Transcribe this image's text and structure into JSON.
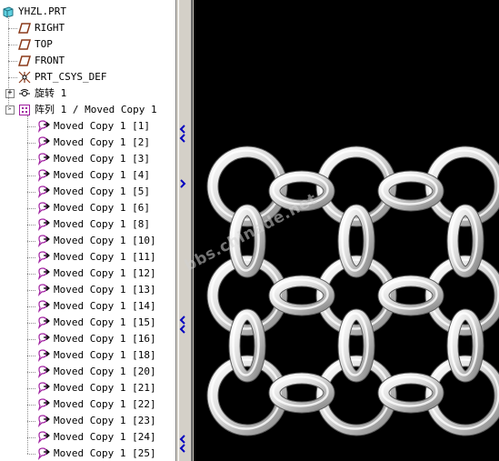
{
  "tree": {
    "root_label": "YHZL.PRT",
    "datum_planes": [
      "RIGHT",
      "TOP",
      "FRONT"
    ],
    "csys_label": "PRT_CSYS_DEF",
    "revolve_label": "旋转 1",
    "pattern_label": "阵列 1 / Moved Copy 1",
    "pattern_children": [
      "Moved Copy 1 [1]",
      "Moved Copy 1 [2]",
      "Moved Copy 1 [3]",
      "Moved Copy 1 [4]",
      "Moved Copy 1 [5]",
      "Moved Copy 1 [6]",
      "Moved Copy 1 [8]",
      "Moved Copy 1 [10]",
      "Moved Copy 1 [11]",
      "Moved Copy 1 [12]",
      "Moved Copy 1 [13]",
      "Moved Copy 1 [14]",
      "Moved Copy 1 [15]",
      "Moved Copy 1 [16]",
      "Moved Copy 1 [18]",
      "Moved Copy 1 [20]",
      "Moved Copy 1 [21]",
      "Moved Copy 1 [22]",
      "Moved Copy 1 [23]",
      "Moved Copy 1 [24]",
      "Moved Copy 1 [25]"
    ]
  },
  "viewport": {
    "background": "#000000",
    "watermark": "bbs.chinade.net"
  },
  "icons": {
    "root": "part-icon",
    "datum": "datum-plane-icon",
    "csys": "coordinate-system-icon",
    "revolve": "revolve-icon",
    "pattern": "pattern-icon",
    "copy": "moved-copy-icon"
  },
  "colors": {
    "tree_background": "#ffffff",
    "sash": "#d4d0c8",
    "sash_arrow": "#0000c0",
    "datum_icon": "#8b3a1a",
    "copy_icon": "#a020a0",
    "rings": "#d8d8d8"
  }
}
